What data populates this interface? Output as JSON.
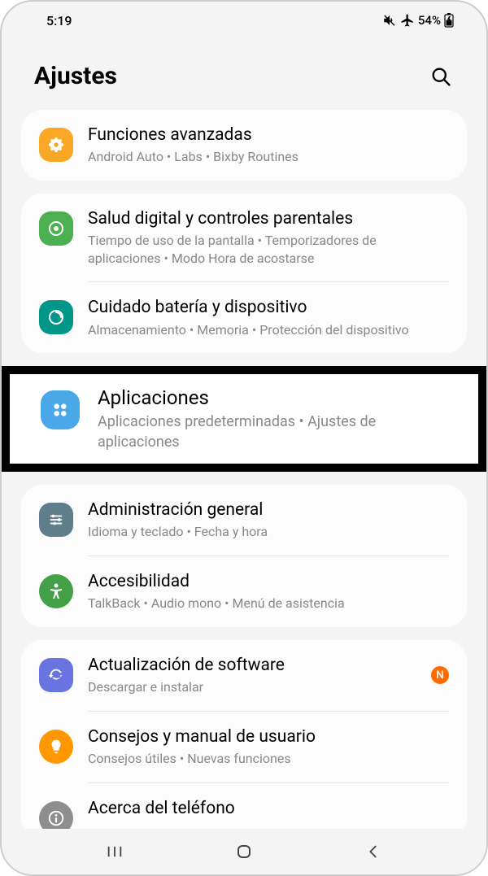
{
  "status": {
    "time": "5:19",
    "battery": "54%"
  },
  "header": {
    "title": "Ajustes"
  },
  "groups": [
    {
      "items": [
        {
          "icon": "advanced",
          "iconColor": "#f9a825",
          "title": "Funciones avanzadas",
          "sub": "Android Auto  •  Labs  •  Bixby Routines"
        }
      ]
    },
    {
      "items": [
        {
          "icon": "wellbeing",
          "iconColor": "#4caf50",
          "title": "Salud digital y controles parentales",
          "sub": "Tiempo de uso de la pantalla  •  Temporizadores de aplicaciones  •  Modo Hora de acostarse"
        },
        {
          "icon": "device-care",
          "iconColor": "#009688",
          "title": "Cuidado batería y dispositivo",
          "sub": "Almacenamiento  •  Memoria  •  Protección del dispositivo"
        }
      ]
    }
  ],
  "highlight": {
    "icon": "apps",
    "iconColor": "#4aa8e8",
    "title": "Aplicaciones",
    "sub": "Aplicaciones predeterminadas  •  Ajustes de aplicaciones"
  },
  "groups2": [
    {
      "items": [
        {
          "icon": "general",
          "iconColor": "#607d8b",
          "title": "Administración general",
          "sub": "Idioma y teclado  •  Fecha y hora"
        },
        {
          "icon": "accessibility",
          "iconColor": "#43a047",
          "title": "Accesibilidad",
          "sub": "TalkBack  •  Audio mono  •  Menú de asistencia"
        }
      ]
    },
    {
      "items": [
        {
          "icon": "update",
          "iconColor": "#6a74e0",
          "title": "Actualización de software",
          "sub": "Descargar e instalar",
          "badge": "N"
        },
        {
          "icon": "tips",
          "iconColor": "#ff9800",
          "title": "Consejos y manual de usuario",
          "sub": "Consejos útiles  •  Nuevas funciones"
        },
        {
          "icon": "about",
          "iconColor": "#8e8e8e",
          "title": "Acerca del teléfono",
          "sub": ""
        }
      ]
    }
  ]
}
